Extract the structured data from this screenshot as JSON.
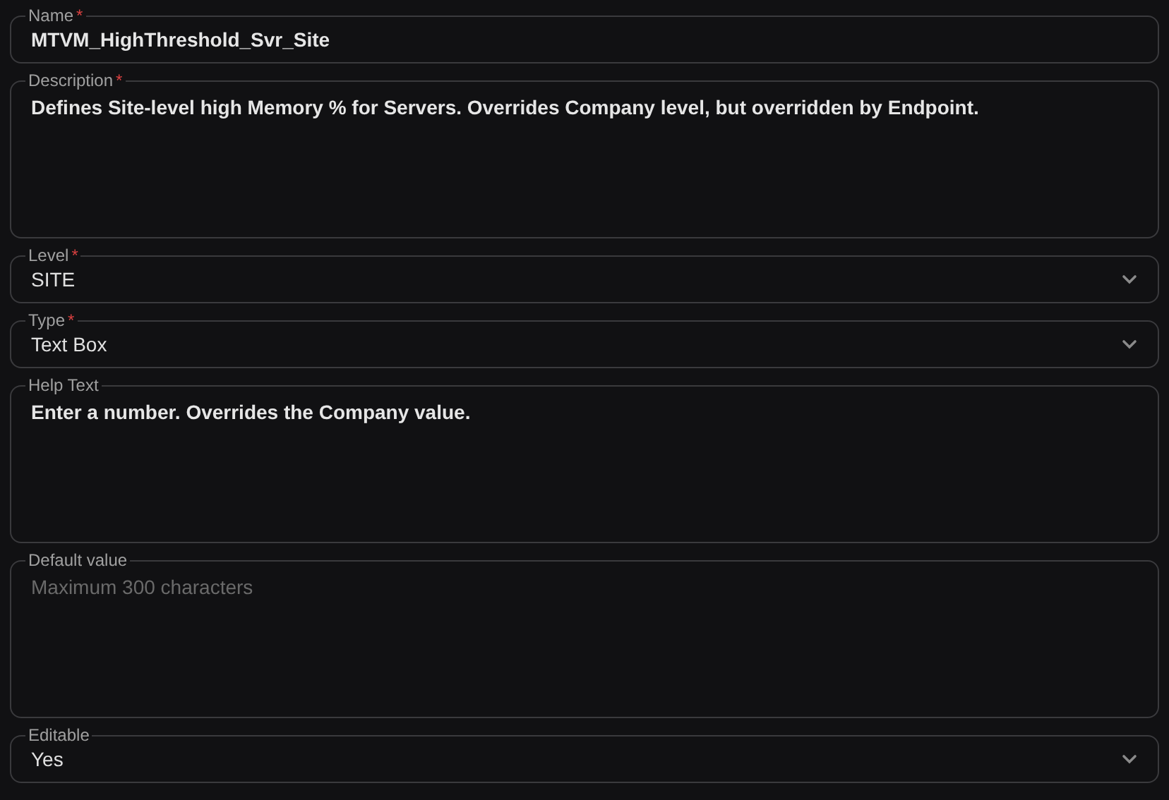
{
  "fields": [
    {
      "kind": "text",
      "label": "Name",
      "required_mark": "*",
      "value": "MTVM_HighThreshold_Svr_Site"
    },
    {
      "kind": "textarea",
      "label": "Description",
      "required_mark": "*",
      "value": "Defines Site-level high Memory % for Servers. Overrides Company level, but overridden by Endpoint."
    },
    {
      "kind": "select",
      "label": "Level",
      "required_mark": "*",
      "value": "SITE"
    },
    {
      "kind": "select",
      "label": "Type",
      "required_mark": "*",
      "value": "Text Box"
    },
    {
      "kind": "textarea",
      "label": "Help Text",
      "value": "Enter a number. Overrides the Company value."
    },
    {
      "kind": "textarea",
      "label": "Default value",
      "placeholder": "Maximum 300 characters"
    },
    {
      "kind": "select",
      "label": "Editable",
      "value": "Yes"
    }
  ]
}
